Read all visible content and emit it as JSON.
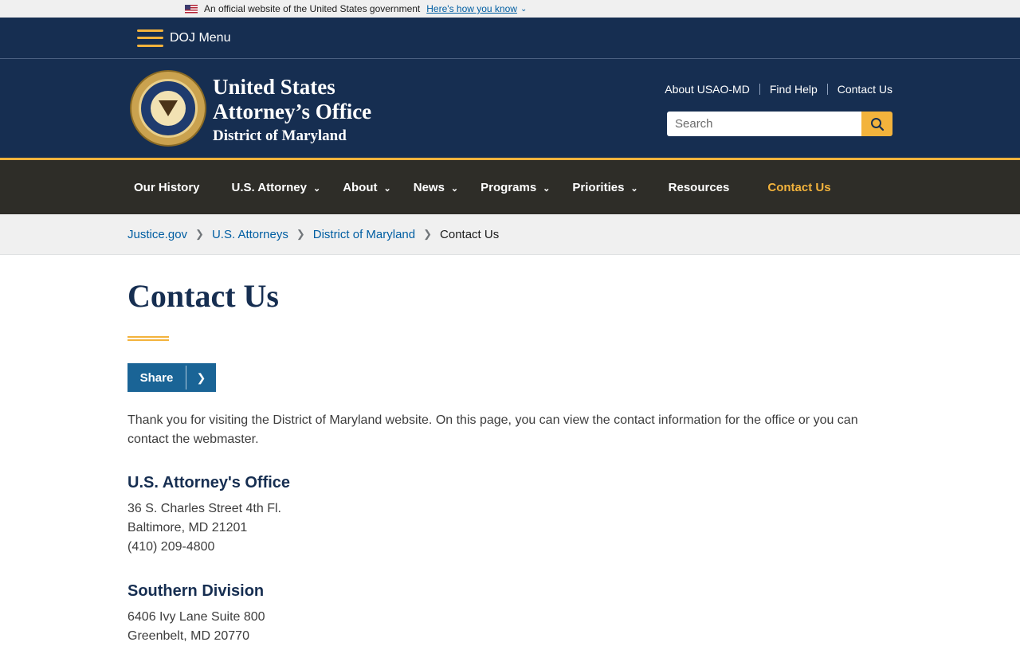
{
  "gov_banner": {
    "text": "An official website of the United States government",
    "link": "Here's how you know"
  },
  "doj_menu": {
    "label": "DOJ Menu"
  },
  "site": {
    "title_line1": "United States",
    "title_line2": "Attorney’s Office",
    "subtitle": "District of Maryland"
  },
  "utility_links": [
    "About USAO-MD",
    "Find Help",
    "Contact Us"
  ],
  "search": {
    "placeholder": "Search"
  },
  "main_nav": [
    {
      "label": "Our History",
      "dropdown": false
    },
    {
      "label": "U.S. Attorney",
      "dropdown": true
    },
    {
      "label": "About",
      "dropdown": true
    },
    {
      "label": "News",
      "dropdown": true
    },
    {
      "label": "Programs",
      "dropdown": true
    },
    {
      "label": "Priorities",
      "dropdown": true
    },
    {
      "label": "Resources",
      "dropdown": false
    },
    {
      "label": "Contact Us",
      "dropdown": false,
      "active": true
    }
  ],
  "breadcrumb": {
    "items": [
      "Justice.gov",
      "U.S. Attorneys",
      "District of Maryland"
    ],
    "current": "Contact Us"
  },
  "page": {
    "title": "Contact Us",
    "share_label": "Share",
    "intro": "Thank you for visiting the District of Maryland website. On this page, you can view the contact information for the office or you can contact the  webmaster."
  },
  "offices": [
    {
      "name": "U.S. Attorney's Office",
      "lines": [
        "36 S. Charles Street 4th Fl.",
        "Baltimore, MD 21201",
        "(410) 209-4800"
      ]
    },
    {
      "name": "Southern Division",
      "lines": [
        "6406 Ivy Lane Suite 800",
        "Greenbelt, MD 20770"
      ]
    }
  ],
  "colors": {
    "navy": "#162e51",
    "gold": "#f3b33c",
    "nav_bg": "#2e2d28",
    "link": "#005ea2",
    "share_bg": "#1a6496"
  }
}
